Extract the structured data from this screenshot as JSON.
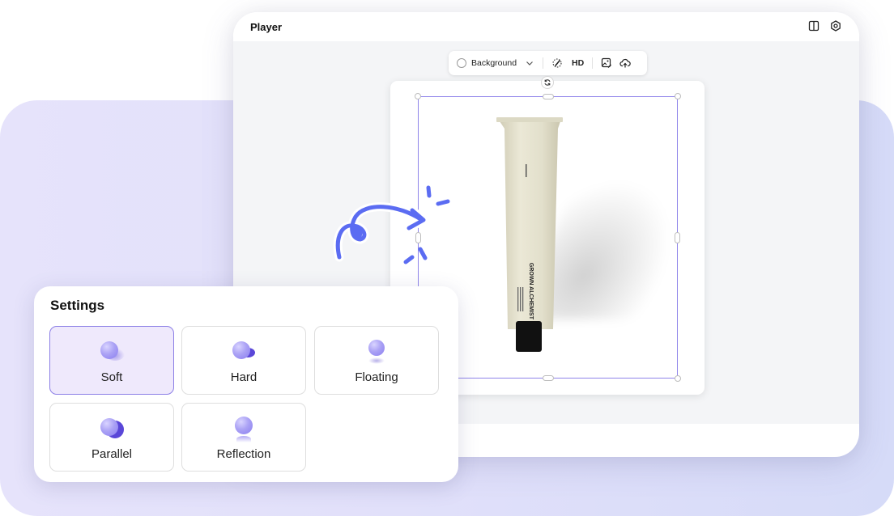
{
  "player": {
    "title": "Player",
    "header_icons": [
      "split-panel-icon",
      "settings-gear-icon"
    ]
  },
  "toolbar": {
    "background_label": "Background",
    "hd_label": "HD",
    "icons": [
      "radio-circle-icon",
      "chevron-down-icon",
      "magic-brush-icon",
      "image-edit-icon",
      "cloud-upload-icon"
    ]
  },
  "canvas": {
    "product_brand": "GROWN ALCHEMIST",
    "selection_color": "#8f84ea"
  },
  "settings": {
    "title": "Settings",
    "selected": "Soft",
    "options": [
      {
        "label": "Soft",
        "icon": "soft-shadow-sphere-icon",
        "active": true
      },
      {
        "label": "Hard",
        "icon": "hard-shadow-sphere-icon",
        "active": false
      },
      {
        "label": "Floating",
        "icon": "floating-shadow-sphere-icon",
        "active": false
      },
      {
        "label": "Parallel",
        "icon": "parallel-shadow-sphere-icon",
        "active": false
      },
      {
        "label": "Reflection",
        "icon": "reflection-shadow-sphere-icon",
        "active": false
      }
    ]
  },
  "colors": {
    "accent": "#8c7fe6",
    "active_fill": "#efe9fc",
    "doodle": "#5b6cf2",
    "backdrop": "#e1e0fa"
  }
}
